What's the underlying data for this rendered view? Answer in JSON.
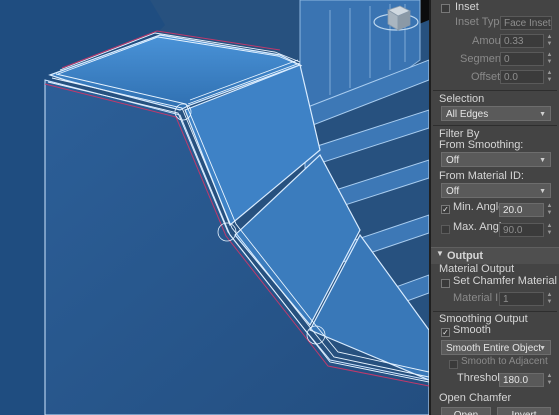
{
  "inset": {
    "checkbox_label": "Inset",
    "type_label": "Inset Type:",
    "type_value": "Face Inset",
    "amount_label": "Amount:",
    "amount_value": "0.33",
    "segments_label": "Segments:",
    "segments_value": "0",
    "offset_label": "Offset:",
    "offset_value": "0.0"
  },
  "selection": {
    "label": "Selection",
    "value": "All Edges"
  },
  "filter_by": {
    "label": "Filter By",
    "from_smoothing_label": "From Smoothing:",
    "from_smoothing_value": "Off",
    "from_material_label": "From Material ID:",
    "from_material_value": "Off",
    "min_angle_label": "Min. Angle:",
    "min_angle_value": "20.0",
    "min_angle_checked": true,
    "max_angle_label": "Max. Angle:",
    "max_angle_value": "90.0",
    "max_angle_checked": false
  },
  "output": {
    "header": "Output",
    "material_output_label": "Material Output",
    "set_chamfer_material_label": "Set Chamfer Material",
    "material_id_label": "Material ID:",
    "material_id_value": "1",
    "smoothing_output_label": "Smoothing Output",
    "smooth_label": "Smooth",
    "smooth_checked": true,
    "smooth_mode_value": "Smooth Entire Object",
    "smooth_to_adjacent_label": "Smooth to Adjacent",
    "threshold_label": "Threshold:",
    "threshold_value": "180.0"
  },
  "open_chamfer": {
    "label": "Open Chamfer",
    "open_button": "Open",
    "invert_button": "Invert"
  },
  "icons": {
    "collapse": "triangle-down-icon",
    "spinner": "spinner-arrows-icon",
    "dropdown": "chevron-down-icon",
    "viewcube": "viewcube-icon"
  },
  "colors": {
    "viewport_bg": "#2a4f7a",
    "mesh_face": "#3b7fc4",
    "mesh_edge": "#cfe6ff",
    "panel_bg": "#444444"
  }
}
